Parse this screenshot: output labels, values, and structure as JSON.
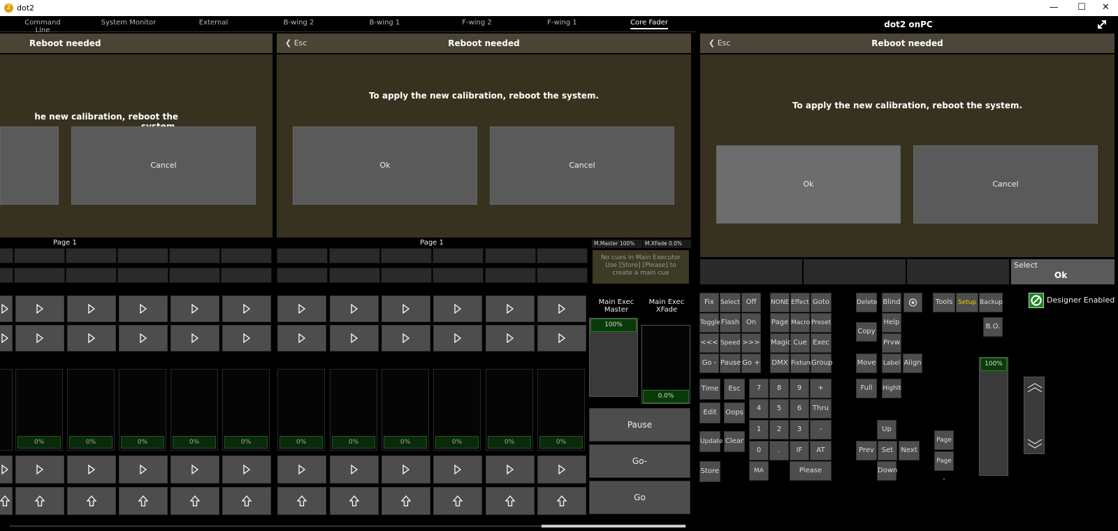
{
  "window": {
    "title": "dot2",
    "app_icon": "dot2-logo-icon",
    "minimize": "—",
    "maximize": "☐",
    "close": "✕"
  },
  "tabs": [
    "Command Line",
    "System Monitor",
    "External",
    "B-wing 2",
    "B-wing 1",
    "F-wing 2",
    "F-wing 1",
    "Core Fader"
  ],
  "active_tab": "Core Fader",
  "onpc_title": "dot2 onPC",
  "popups": {
    "title": "Reboot needed",
    "message": "To apply the new calibration, reboot the system.",
    "message_clipped": "he new calibration, reboot the system.",
    "esc": "Esc",
    "ok": "Ok",
    "cancel": "Cancel"
  },
  "wings": {
    "left_page": "Page 1",
    "right_page": "Page 1"
  },
  "main_exec": {
    "master_label": "M.Master 100%",
    "xfade_label": "M.XFade  0.0%",
    "no_cues": "No cues in Main Executor Use [Store] [Please] to create a main cue",
    "master_title": "Main Exec Master",
    "xfade_title": "Main Exec XFade",
    "master_value": "100%",
    "master_level": 1.0,
    "xfade_value": "0.0%",
    "xfade_level": 0.0,
    "pause": "Pause",
    "go_minus": "Go-",
    "go": "Go"
  },
  "fader_values": [
    "0%",
    "0%",
    "0%",
    "0%",
    "0%",
    "0%",
    "0%",
    "0%",
    "0%",
    "0%",
    "0%"
  ],
  "select_bar": {
    "label": "Select",
    "value": "Ok"
  },
  "keys": {
    "fix": "Fix",
    "select": "Select",
    "off": "Off",
    "none": "NONE",
    "effect": "Effect",
    "goto": "Goto",
    "toggle": "Toggle",
    "flash": "Flash",
    "on": "On",
    "page": "Page",
    "macro": "Macro",
    "preset": "Preset",
    "back": "<<<",
    "speed": "Speed",
    "fwd": ">>>",
    "magic": "Magic",
    "cue": "Cue",
    "exec": "Exec",
    "gominus": "Go -",
    "pause": "Pause",
    "goplus": "Go +",
    "dmx": "DMX",
    "fixture": "Fixture",
    "group": "Group",
    "time": "Time",
    "esc": "Esc",
    "edit": "Edit",
    "oops": "Oops",
    "update": "Update",
    "clear": "Clear",
    "store": "Store",
    "n7": "7",
    "n8": "8",
    "n9": "9",
    "plus": "+",
    "n4": "4",
    "n5": "5",
    "n6": "6",
    "thru": "Thru",
    "n1": "1",
    "n2": "2",
    "n3": "3",
    "minus": "-",
    "n0": "0",
    "dot": ".",
    "if": "IF",
    "at": "AT",
    "ma": "MA",
    "please": "Please",
    "delete": "Delete",
    "blind": "Blind",
    "help": "Help",
    "copy": "Copy",
    "prvw": "Prvw",
    "move": "Move",
    "label": "Label",
    "align": "Align",
    "full": "Full",
    "highlt": "Highlt",
    "tools": "Tools",
    "setup": "Setup",
    "backup": "Backup",
    "bo": "B.O.",
    "up": "Up",
    "prev": "Prev",
    "set": "Set",
    "next": "Next",
    "down": "Down",
    "page_plus": "Page +",
    "page_minus": "Page -",
    "designer": "Designer Enabled",
    "grand_master": "100%",
    "grand_master_level": 1.0
  }
}
